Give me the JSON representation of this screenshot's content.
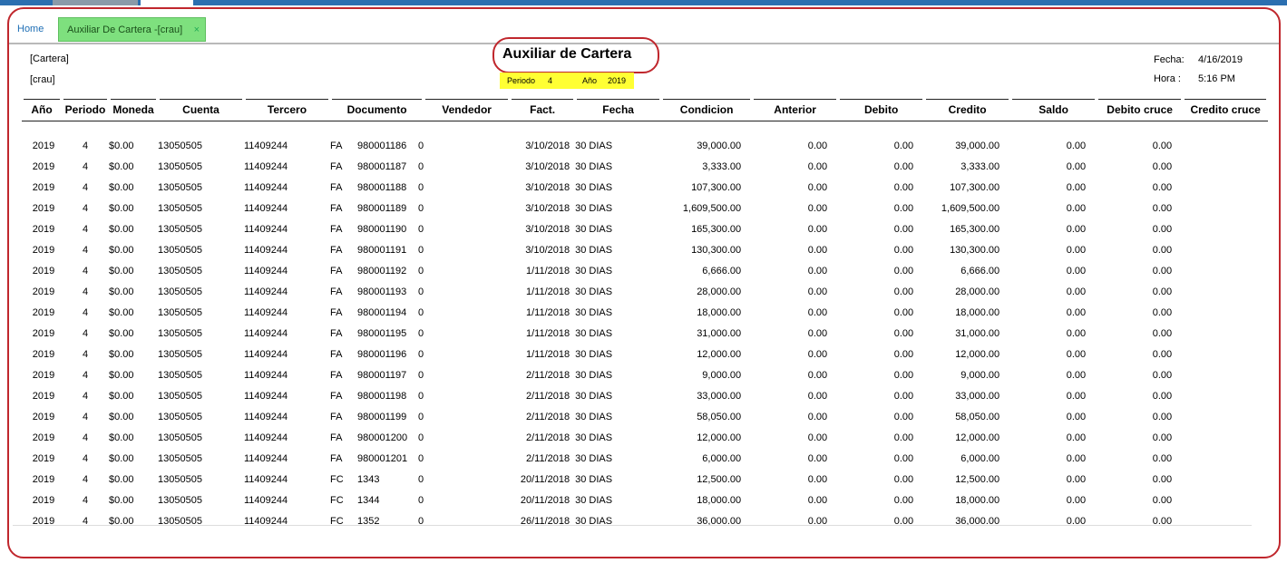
{
  "tabs": {
    "home": "Home",
    "active": "Auxiliar De Cartera -[crau]",
    "close": "×"
  },
  "report": {
    "left1": "[Cartera]",
    "left2": "[crau]",
    "title": "Auxiliar de Cartera",
    "periodo_label": "Periodo",
    "periodo_value": "4",
    "anio_label": "Año",
    "anio_value": "2019",
    "fecha_label": "Fecha:",
    "fecha_value": "4/16/2019",
    "hora_label": "Hora :",
    "hora_value": "5:16 PM"
  },
  "columns": [
    "Año",
    "Periodo",
    "Moneda",
    "Cuenta",
    "Tercero",
    "Documento",
    "Vendedor",
    "Fact.",
    "Fecha",
    "Condicion",
    "Anterior",
    "Debito",
    "Credito",
    "Saldo",
    "Debito cruce",
    "Credito cruce"
  ],
  "rows": [
    [
      "2019",
      "4",
      "$0.00",
      "13050505",
      "11409244",
      "FA",
      "980001186",
      "0",
      "",
      "3/10/2018",
      "30 DIAS",
      "39,000.00",
      "0.00",
      "0.00",
      "39,000.00",
      "0.00",
      "0.00"
    ],
    [
      "2019",
      "4",
      "$0.00",
      "13050505",
      "11409244",
      "FA",
      "980001187",
      "0",
      "",
      "3/10/2018",
      "30 DIAS",
      "3,333.00",
      "0.00",
      "0.00",
      "3,333.00",
      "0.00",
      "0.00"
    ],
    [
      "2019",
      "4",
      "$0.00",
      "13050505",
      "11409244",
      "FA",
      "980001188",
      "0",
      "",
      "3/10/2018",
      "30 DIAS",
      "107,300.00",
      "0.00",
      "0.00",
      "107,300.00",
      "0.00",
      "0.00"
    ],
    [
      "2019",
      "4",
      "$0.00",
      "13050505",
      "11409244",
      "FA",
      "980001189",
      "0",
      "",
      "3/10/2018",
      "30 DIAS",
      "1,609,500.00",
      "0.00",
      "0.00",
      "1,609,500.00",
      "0.00",
      "0.00"
    ],
    [
      "2019",
      "4",
      "$0.00",
      "13050505",
      "11409244",
      "FA",
      "980001190",
      "0",
      "",
      "3/10/2018",
      "30 DIAS",
      "165,300.00",
      "0.00",
      "0.00",
      "165,300.00",
      "0.00",
      "0.00"
    ],
    [
      "2019",
      "4",
      "$0.00",
      "13050505",
      "11409244",
      "FA",
      "980001191",
      "0",
      "",
      "3/10/2018",
      "30 DIAS",
      "130,300.00",
      "0.00",
      "0.00",
      "130,300.00",
      "0.00",
      "0.00"
    ],
    [
      "2019",
      "4",
      "$0.00",
      "13050505",
      "11409244",
      "FA",
      "980001192",
      "0",
      "",
      "1/11/2018",
      "30 DIAS",
      "6,666.00",
      "0.00",
      "0.00",
      "6,666.00",
      "0.00",
      "0.00"
    ],
    [
      "2019",
      "4",
      "$0.00",
      "13050505",
      "11409244",
      "FA",
      "980001193",
      "0",
      "",
      "1/11/2018",
      "30 DIAS",
      "28,000.00",
      "0.00",
      "0.00",
      "28,000.00",
      "0.00",
      "0.00"
    ],
    [
      "2019",
      "4",
      "$0.00",
      "13050505",
      "11409244",
      "FA",
      "980001194",
      "0",
      "",
      "1/11/2018",
      "30 DIAS",
      "18,000.00",
      "0.00",
      "0.00",
      "18,000.00",
      "0.00",
      "0.00"
    ],
    [
      "2019",
      "4",
      "$0.00",
      "13050505",
      "11409244",
      "FA",
      "980001195",
      "0",
      "",
      "1/11/2018",
      "30 DIAS",
      "31,000.00",
      "0.00",
      "0.00",
      "31,000.00",
      "0.00",
      "0.00"
    ],
    [
      "2019",
      "4",
      "$0.00",
      "13050505",
      "11409244",
      "FA",
      "980001196",
      "0",
      "",
      "1/11/2018",
      "30 DIAS",
      "12,000.00",
      "0.00",
      "0.00",
      "12,000.00",
      "0.00",
      "0.00"
    ],
    [
      "2019",
      "4",
      "$0.00",
      "13050505",
      "11409244",
      "FA",
      "980001197",
      "0",
      "",
      "2/11/2018",
      "30 DIAS",
      "9,000.00",
      "0.00",
      "0.00",
      "9,000.00",
      "0.00",
      "0.00"
    ],
    [
      "2019",
      "4",
      "$0.00",
      "13050505",
      "11409244",
      "FA",
      "980001198",
      "0",
      "",
      "2/11/2018",
      "30 DIAS",
      "33,000.00",
      "0.00",
      "0.00",
      "33,000.00",
      "0.00",
      "0.00"
    ],
    [
      "2019",
      "4",
      "$0.00",
      "13050505",
      "11409244",
      "FA",
      "980001199",
      "0",
      "",
      "2/11/2018",
      "30 DIAS",
      "58,050.00",
      "0.00",
      "0.00",
      "58,050.00",
      "0.00",
      "0.00"
    ],
    [
      "2019",
      "4",
      "$0.00",
      "13050505",
      "11409244",
      "FA",
      "980001200",
      "0",
      "",
      "2/11/2018",
      "30 DIAS",
      "12,000.00",
      "0.00",
      "0.00",
      "12,000.00",
      "0.00",
      "0.00"
    ],
    [
      "2019",
      "4",
      "$0.00",
      "13050505",
      "11409244",
      "FA",
      "980001201",
      "0",
      "",
      "2/11/2018",
      "30 DIAS",
      "6,000.00",
      "0.00",
      "0.00",
      "6,000.00",
      "0.00",
      "0.00"
    ],
    [
      "2019",
      "4",
      "$0.00",
      "13050505",
      "11409244",
      "FC",
      "1343",
      "0",
      "",
      "20/11/2018",
      "30 DIAS",
      "12,500.00",
      "0.00",
      "0.00",
      "12,500.00",
      "0.00",
      "0.00"
    ],
    [
      "2019",
      "4",
      "$0.00",
      "13050505",
      "11409244",
      "FC",
      "1344",
      "0",
      "",
      "20/11/2018",
      "30 DIAS",
      "18,000.00",
      "0.00",
      "0.00",
      "18,000.00",
      "0.00",
      "0.00"
    ],
    [
      "2019",
      "4",
      "$0.00",
      "13050505",
      "11409244",
      "FC",
      "1352",
      "0",
      "",
      "26/11/2018",
      "30 DIAS",
      "36,000.00",
      "0.00",
      "0.00",
      "36,000.00",
      "0.00",
      "0.00"
    ]
  ]
}
